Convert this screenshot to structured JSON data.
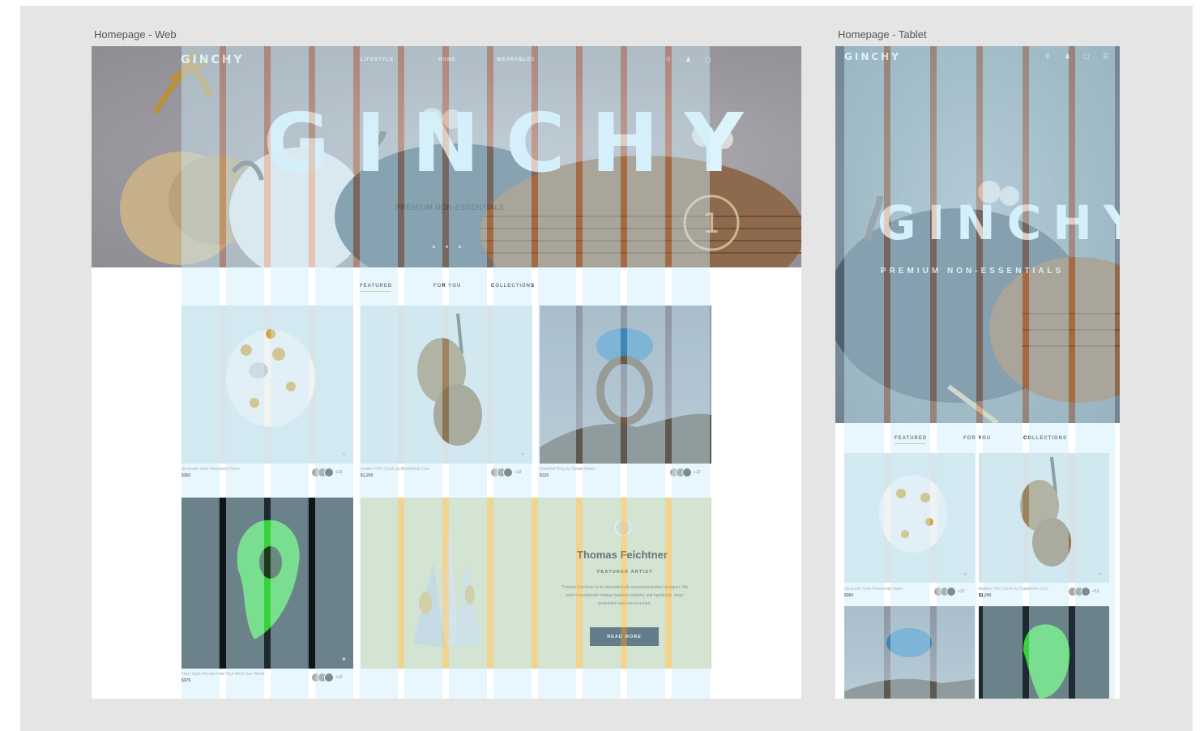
{
  "frames": {
    "web_label": "Homepage - Web",
    "tablet_label": "Homepage - Tablet"
  },
  "brand": {
    "logo": "GINCHY"
  },
  "nav": {
    "lifestyle": "LIFESTYLE",
    "home": "HOME",
    "wearables": "WEARABLES"
  },
  "icons": {
    "search": "search-icon",
    "account": "user-icon",
    "cart": "bag-icon",
    "menu": "menu-icon"
  },
  "hero": {
    "title": "GINCHY",
    "subtitle_web": "PREMIUM NON-ESSENTIALS",
    "subtitle_tablet": "PREMIUM NON-ESSENTIALS",
    "badge": "1"
  },
  "tabs": {
    "featured": "FEATURED",
    "for_you": "FOR YOU",
    "collections": "COLLECTIONS"
  },
  "products": [
    {
      "name": "Skull with Gold Flowers by Noon",
      "price": "$360",
      "count": "+12"
    },
    {
      "name": "Golden TKO Clock by ClockWork Croc",
      "price": "$1,200",
      "count": "+12"
    },
    {
      "name": "Waterfall Ring by Secret Wood",
      "price": "$120",
      "count": "+12"
    },
    {
      "name": "Fiber Optic Hoodie from Your Mind Your World",
      "price": "$375",
      "count": "+12"
    }
  ],
  "artist": {
    "name": "Thomas Feichtner",
    "role": "FEATURED ARTIST",
    "bio": "Thomas Feichtner is an internationally renowned product designer. His work is positioned midway between industry and handicraft, mass production and one-of-a-kind.",
    "cta": "READ MORE"
  },
  "colors": {
    "grid_overlay": "#cdeefa",
    "grid_gutter_hero": "#e36b2c",
    "grid_gutter_artist": "#ffcf7a",
    "artist_bg": "#d9dcb2",
    "cta_bg": "#0e2230",
    "tab_underline": "#9fbf6a"
  }
}
